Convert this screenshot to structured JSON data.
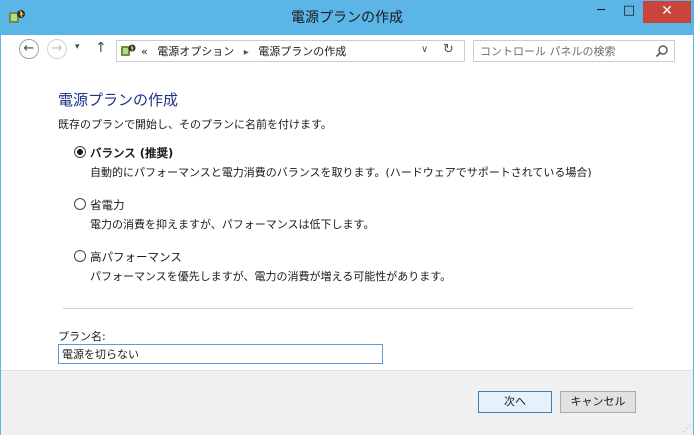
{
  "window": {
    "title": "電源プランの作成",
    "minimize_glyph": "─",
    "maximize_glyph": "□",
    "close_glyph": "✕"
  },
  "toolbar": {
    "back_glyph": "←",
    "forward_glyph": "→",
    "recent_glyph": "▾",
    "up_glyph": "↑",
    "breadcrumb": {
      "overflow": "«",
      "items": [
        "電源オプション",
        "電源プランの作成"
      ],
      "separator": "▸"
    },
    "address_dropdown_glyph": "∨",
    "refresh_glyph": "↻",
    "search_placeholder": "コントロール パネルの検索"
  },
  "main": {
    "heading": "電源プランの作成",
    "description": "既存のプランで開始し、そのプランに名前を付けます。",
    "options": [
      {
        "label": "バランス (推奨)",
        "description": "自動的にパフォーマンスと電力消費のバランスを取ります。(ハードウェアでサポートされている場合)",
        "checked": true
      },
      {
        "label": "省電力",
        "description": "電力の消費を抑えますが、パフォーマンスは低下します。",
        "checked": false
      },
      {
        "label": "高パフォーマンス",
        "description": "パフォーマンスを優先しますが、電力の消費が増える可能性があります。",
        "checked": false
      }
    ],
    "plan_name_label": "プラン名:",
    "plan_name_value": "電源を切らない"
  },
  "footer": {
    "next_label": "次へ",
    "cancel_label": "キャンセル"
  },
  "colors": {
    "titlebar": "#5cb5e7",
    "close_button": "#c7453b",
    "heading": "#1e3287",
    "input_border": "#5a9bd5"
  }
}
